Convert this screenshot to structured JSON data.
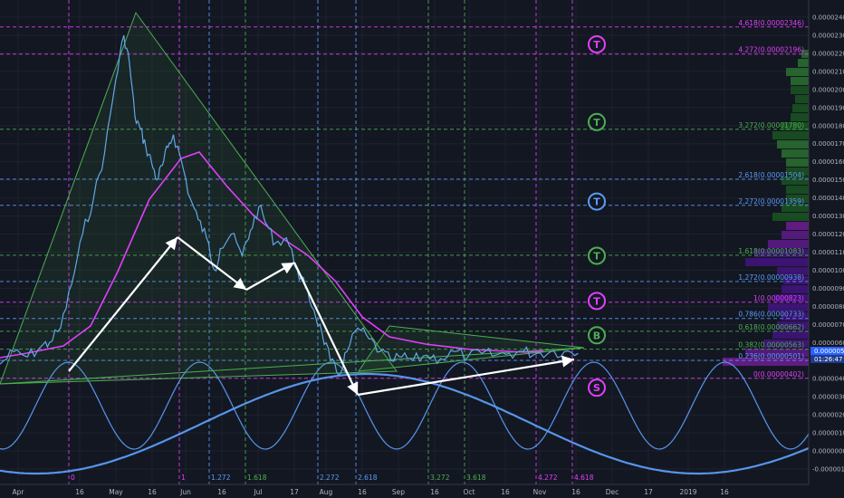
{
  "chart_data": {
    "type": "line",
    "title": "",
    "xlabel": "",
    "ylabel": "",
    "ylim": [
      -1e-06,
      2.44e-05
    ],
    "x_tick_labels": [
      "Apr",
      "16",
      "May",
      "16",
      "Jun",
      "16",
      "Jul",
      "17",
      "Aug",
      "16",
      "Sep",
      "16",
      "Oct",
      "16",
      "Nov",
      "16",
      "Dec",
      "17",
      "2019",
      "16"
    ],
    "y_tick_labels": [
      "0.00002400",
      "0.00002300",
      "0.00002200",
      "0.00002100",
      "0.00002000",
      "0.00001900",
      "0.00001800",
      "0.00001700",
      "0.00001600",
      "0.00001500",
      "0.00001400",
      "0.00001300",
      "0.00001200",
      "0.00001100",
      "0.00001000",
      "0.00000900",
      "0.00000800",
      "0.00000700",
      "0.00000600",
      "0.00000500",
      "0.00000400",
      "0.00000300",
      "0.00000200",
      "0.00000100",
      "0.00000000",
      "-0.00000100"
    ],
    "price_series": {
      "days": [
        0,
        5,
        10,
        15,
        18,
        22,
        26,
        30,
        34,
        38,
        42,
        45,
        47,
        49,
        51,
        53,
        55,
        57,
        59,
        61,
        63,
        66,
        69,
        72,
        75,
        78,
        80,
        84,
        88,
        91,
        94,
        97,
        100,
        104,
        108,
        111,
        114,
        117,
        120,
        123,
        126,
        130,
        134,
        138,
        142,
        146,
        150,
        155,
        160,
        165,
        170,
        175,
        180,
        185,
        190,
        195,
        200,
        205,
        210
      ],
      "values": [
        4.8e-06,
        5.5e-06,
        5.2e-06,
        5.8e-06,
        6e-06,
        6.8e-06,
        9.2e-06,
        1.2e-05,
        1.4e-05,
        1.65e-05,
        2.05e-05,
        2.3e-05,
        2.15e-05,
        1.85e-05,
        1.78e-05,
        1.68e-05,
        1.6e-05,
        1.5e-05,
        1.58e-05,
        1.68e-05,
        1.75e-05,
        1.6e-05,
        1.4e-05,
        1.28e-05,
        1.18e-05,
        1e-05,
        1.12e-05,
        1.2e-05,
        1.08e-05,
        1.22e-05,
        1.35e-05,
        1.25e-05,
        1.15e-05,
        1.18e-05,
        1e-05,
        9e-06,
        7.8e-06,
        6.5e-06,
        5e-06,
        4.2e-06,
        5.5e-06,
        6.8e-06,
        6.2e-06,
        5.5e-06,
        5e-06,
        5.2e-06,
        5e-06,
        5.3e-06,
        5.1e-06,
        5.5e-06,
        5.2e-06,
        5.4e-06,
        5.3e-06,
        5.4e-06,
        5.5e-06,
        5.4e-06,
        5.5e-06,
        5.5e-06,
        5.4e-06
      ]
    },
    "fib_levels": [
      {
        "ratio": "4.618",
        "price": "0.00002346",
        "value": 2.346e-05,
        "color": "#e040fb"
      },
      {
        "ratio": "4.272",
        "price": "0.00002196",
        "value": 2.196e-05,
        "color": "#e040fb"
      },
      {
        "ratio": "3.272",
        "price": "0.00001780",
        "value": 1.78e-05,
        "color": "#4caf50"
      },
      {
        "ratio": "2.618",
        "price": "0.00001504",
        "value": 1.504e-05,
        "color": "#5b9cf6"
      },
      {
        "ratio": "2.272",
        "price": "0.00001359",
        "value": 1.359e-05,
        "color": "#5b9cf6"
      },
      {
        "ratio": "1.618",
        "price": "0.00001083",
        "value": 1.083e-05,
        "color": "#4caf50"
      },
      {
        "ratio": "1.272",
        "price": "0.00000938",
        "value": 9.38e-06,
        "color": "#5b9cf6"
      },
      {
        "ratio": "1",
        "price": "0.00000823",
        "value": 8.23e-06,
        "color": "#e040fb"
      },
      {
        "ratio": "0.786",
        "price": "0.00000733",
        "value": 7.33e-06,
        "color": "#5b9cf6"
      },
      {
        "ratio": "0.618",
        "price": "0.00000662",
        "value": 6.62e-06,
        "color": "#4caf50"
      },
      {
        "ratio": "0.382",
        "price": "0.00000563",
        "value": 5.63e-06,
        "color": "#4caf50"
      },
      {
        "ratio": "0.236",
        "price": "0.00000501",
        "value": 5.01e-06,
        "color": "#5b9cf6"
      },
      {
        "ratio": "0",
        "price": "0.00000402",
        "value": 4.02e-06,
        "color": "#e040fb"
      }
    ],
    "vertical_fib_labels": [
      "0",
      "1",
      "1.272",
      "1.618",
      "2.272",
      "2.618",
      "3.272",
      "3.618",
      "4.272",
      "4.618"
    ],
    "badges": [
      {
        "letter": "T",
        "color": "#e040fb",
        "value": 2.25e-05
      },
      {
        "letter": "T",
        "color": "#4caf50",
        "value": 1.82e-05
      },
      {
        "letter": "T",
        "color": "#5b9cf6",
        "value": 1.38e-05
      },
      {
        "letter": "T",
        "color": "#4caf50",
        "value": 1.08e-05
      },
      {
        "letter": "T",
        "color": "#e040fb",
        "value": 8.3e-06
      },
      {
        "letter": "B",
        "color": "#4caf50",
        "value": 6.4e-06
      },
      {
        "letter": "S",
        "color": "#e040fb",
        "value": 3.5e-06
      }
    ],
    "current_price": "0.00000545",
    "countdown": "01:26:47"
  }
}
